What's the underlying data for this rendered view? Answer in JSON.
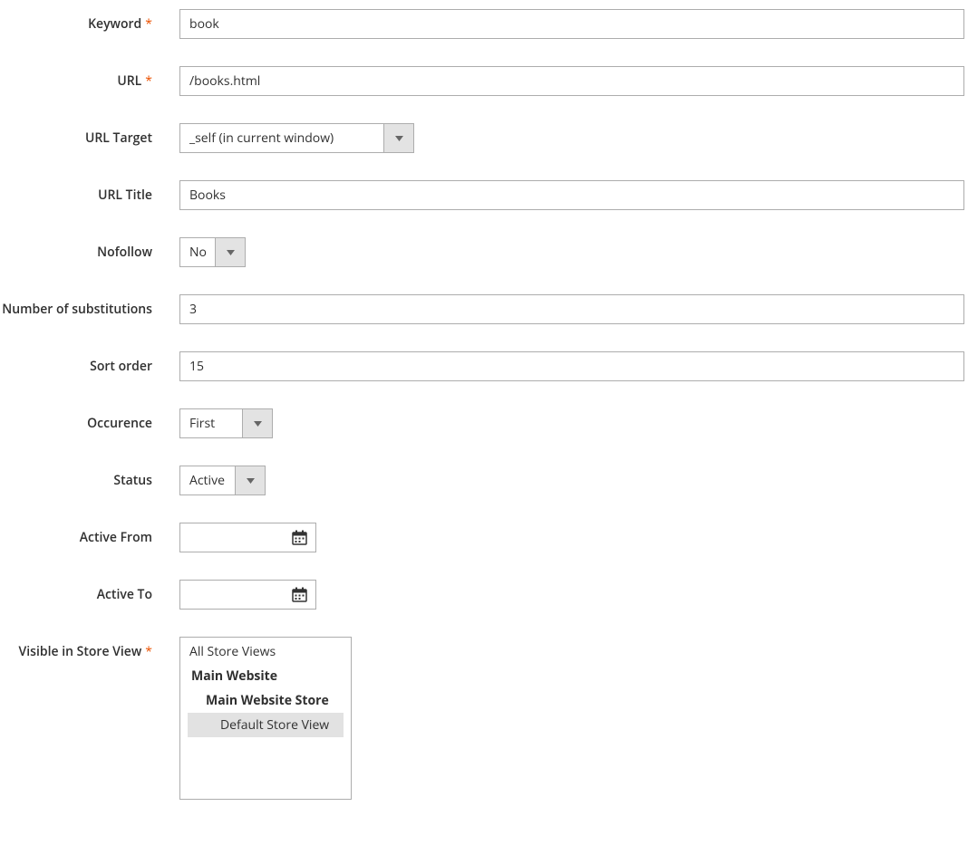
{
  "labels": {
    "keyword": "Keyword",
    "url": "URL",
    "url_target": "URL Target",
    "url_title": "URL Title",
    "nofollow": "Nofollow",
    "num_subs": "Number of substitutions",
    "sort_order": "Sort order",
    "occurrence": "Occurence",
    "status": "Status",
    "active_from": "Active From",
    "active_to": "Active To",
    "visible_in": "Visible in Store View"
  },
  "fields": {
    "keyword": "book",
    "url": "/books.html",
    "url_target": "_self (in current window)",
    "url_title": "Books",
    "nofollow": "No",
    "num_subs": "3",
    "sort_order": "15",
    "occurrence": "First",
    "status": "Active",
    "active_from": "",
    "active_to": ""
  },
  "store_views": {
    "all": "All Store Views",
    "website": "Main Website",
    "store": "Main Website Store",
    "view": "Default Store View"
  }
}
